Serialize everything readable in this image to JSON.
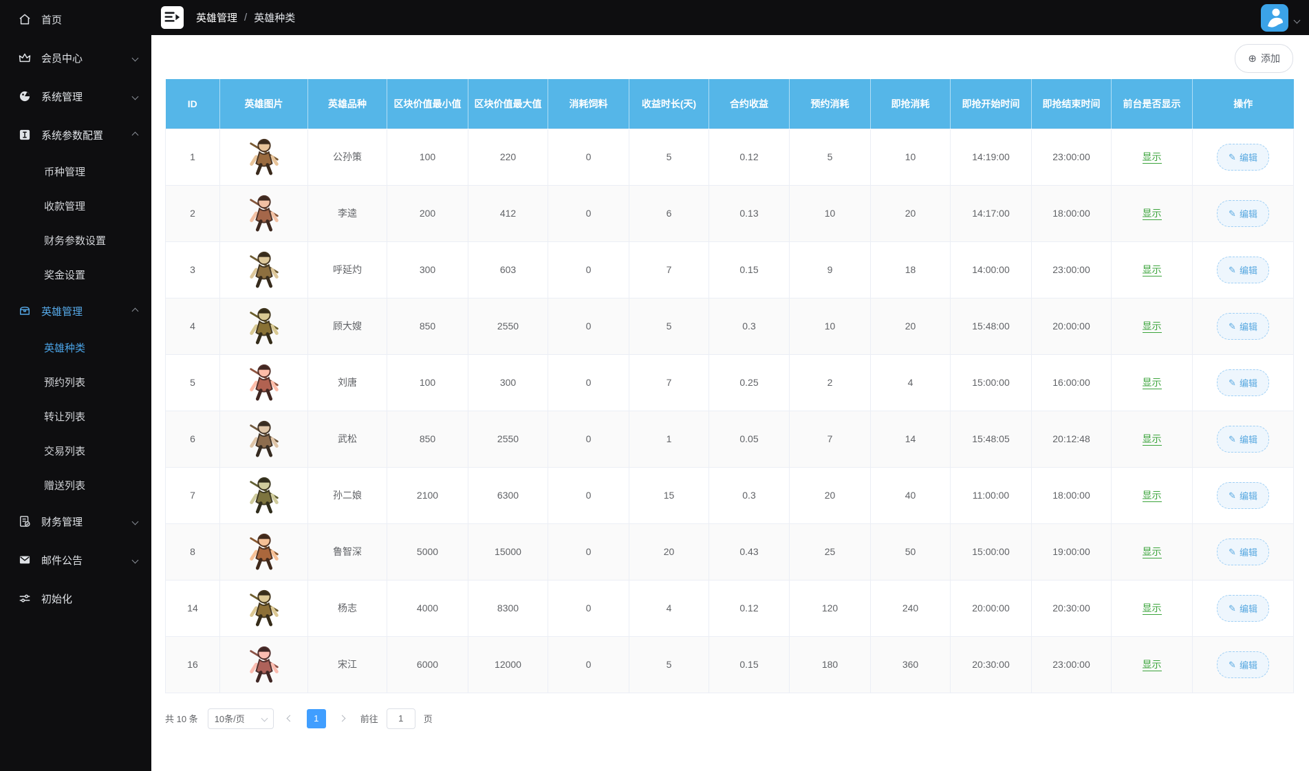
{
  "colors": {
    "table_header_blue": "#55b6e8",
    "accent_blue": "#409eff",
    "active_menu_blue": "#56a9e8",
    "success_green": "#3aa33a",
    "sidebar_bg": "#0e0e10"
  },
  "header": {
    "breadcrumb_parent": "英雄管理",
    "breadcrumb_separator": "/",
    "breadcrumb_current": "英雄种类"
  },
  "sidebar": {
    "items": [
      {
        "key": "home",
        "label": "首页",
        "icon": "home-icon",
        "chevron": null,
        "active": false
      },
      {
        "key": "member-center",
        "label": "会员中心",
        "icon": "crown-icon",
        "chevron": "down",
        "active": false
      },
      {
        "key": "system-management",
        "label": "系统管理",
        "icon": "globe-icon",
        "chevron": "down",
        "active": false
      },
      {
        "key": "system-params",
        "label": "系统参数配置",
        "icon": "info-box-icon",
        "chevron": "up",
        "active": false,
        "children": [
          {
            "key": "coin-management",
            "label": "币种管理",
            "active": false
          },
          {
            "key": "payment-management",
            "label": "收款管理",
            "active": false
          },
          {
            "key": "finance-params",
            "label": "财务参数设置",
            "active": false
          },
          {
            "key": "bonus-settings",
            "label": "奖金设置",
            "active": false
          }
        ]
      },
      {
        "key": "hero-management",
        "label": "英雄管理",
        "icon": "chest-icon",
        "chevron": "up",
        "active": true,
        "children": [
          {
            "key": "hero-types",
            "label": "英雄种类",
            "active": true
          },
          {
            "key": "reserve-list",
            "label": "预约列表",
            "active": false
          },
          {
            "key": "transfer-list",
            "label": "转让列表",
            "active": false
          },
          {
            "key": "trade-list",
            "label": "交易列表",
            "active": false
          },
          {
            "key": "gift-list",
            "label": "赠送列表",
            "active": false
          }
        ]
      },
      {
        "key": "finance-management",
        "label": "财务管理",
        "icon": "finance-icon",
        "chevron": "down",
        "active": false
      },
      {
        "key": "mail-announcement",
        "label": "邮件公告",
        "icon": "mail-icon",
        "chevron": "down",
        "active": false
      },
      {
        "key": "initialization",
        "label": "初始化",
        "icon": "sliders-icon",
        "chevron": null,
        "active": false
      }
    ]
  },
  "toolbar": {
    "add_label": "添加"
  },
  "table": {
    "columns": [
      "ID",
      "英雄图片",
      "英雄品种",
      "区块价值最小值",
      "区块价值最大值",
      "消耗饲料",
      "收益时长(天)",
      "合约收益",
      "预约消耗",
      "即抢消耗",
      "即抢开始时间",
      "即抢结束时间",
      "前台是否显示",
      "操作"
    ],
    "show_label": "显示",
    "edit_label": "编辑",
    "rows": [
      {
        "id": "1",
        "name": "公孙策",
        "min": "100",
        "max": "220",
        "feed": "0",
        "days": "5",
        "profit": "0.12",
        "reserve": "5",
        "grab": "10",
        "start": "14:19:00",
        "end": "23:00:00"
      },
      {
        "id": "2",
        "name": "李逵",
        "min": "200",
        "max": "412",
        "feed": "0",
        "days": "6",
        "profit": "0.13",
        "reserve": "10",
        "grab": "20",
        "start": "14:17:00",
        "end": "18:00:00"
      },
      {
        "id": "3",
        "name": "呼延灼",
        "min": "300",
        "max": "603",
        "feed": "0",
        "days": "7",
        "profit": "0.15",
        "reserve": "9",
        "grab": "18",
        "start": "14:00:00",
        "end": "23:00:00"
      },
      {
        "id": "4",
        "name": "顾大嫂",
        "min": "850",
        "max": "2550",
        "feed": "0",
        "days": "5",
        "profit": "0.3",
        "reserve": "10",
        "grab": "20",
        "start": "15:48:00",
        "end": "20:00:00"
      },
      {
        "id": "5",
        "name": "刘唐",
        "min": "100",
        "max": "300",
        "feed": "0",
        "days": "7",
        "profit": "0.25",
        "reserve": "2",
        "grab": "4",
        "start": "15:00:00",
        "end": "16:00:00"
      },
      {
        "id": "6",
        "name": "武松",
        "min": "850",
        "max": "2550",
        "feed": "0",
        "days": "1",
        "profit": "0.05",
        "reserve": "7",
        "grab": "14",
        "start": "15:48:05",
        "end": "20:12:48"
      },
      {
        "id": "7",
        "name": "孙二娘",
        "min": "2100",
        "max": "6300",
        "feed": "0",
        "days": "15",
        "profit": "0.3",
        "reserve": "20",
        "grab": "40",
        "start": "11:00:00",
        "end": "18:00:00"
      },
      {
        "id": "8",
        "name": "鲁智深",
        "min": "5000",
        "max": "15000",
        "feed": "0",
        "days": "20",
        "profit": "0.43",
        "reserve": "25",
        "grab": "50",
        "start": "15:00:00",
        "end": "19:00:00"
      },
      {
        "id": "14",
        "name": "杨志",
        "min": "4000",
        "max": "8300",
        "feed": "0",
        "days": "4",
        "profit": "0.12",
        "reserve": "120",
        "grab": "240",
        "start": "20:00:00",
        "end": "20:30:00"
      },
      {
        "id": "16",
        "name": "宋江",
        "min": "6000",
        "max": "12000",
        "feed": "0",
        "days": "5",
        "profit": "0.15",
        "reserve": "180",
        "grab": "360",
        "start": "20:30:00",
        "end": "23:00:00"
      }
    ]
  },
  "pagination": {
    "total": "共 10 条",
    "page_size": "10条/页",
    "current": "1",
    "goto_prefix": "前往",
    "goto_value": "1",
    "goto_suffix": "页"
  }
}
